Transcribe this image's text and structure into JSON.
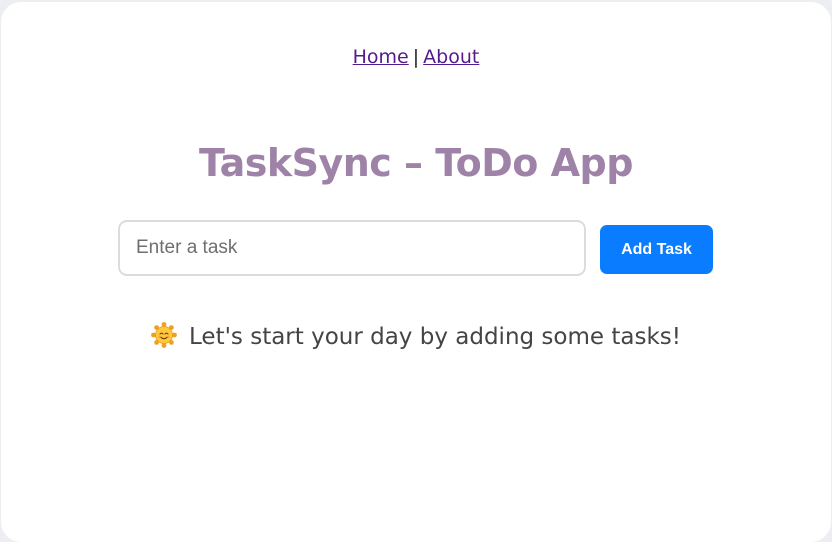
{
  "nav": {
    "home_label": "Home",
    "separator": "|",
    "about_label": "About"
  },
  "app": {
    "title": "TaskSync – ToDo App"
  },
  "task_form": {
    "input_placeholder": "Enter a task",
    "input_value": "",
    "add_button_label": "Add Task"
  },
  "empty_state": {
    "icon": "smiling-sun-icon",
    "message": "Let's start your day by adding some tasks!"
  },
  "colors": {
    "title": "#9f82a7",
    "button": "#0a7cff",
    "link": "#551a8b"
  }
}
